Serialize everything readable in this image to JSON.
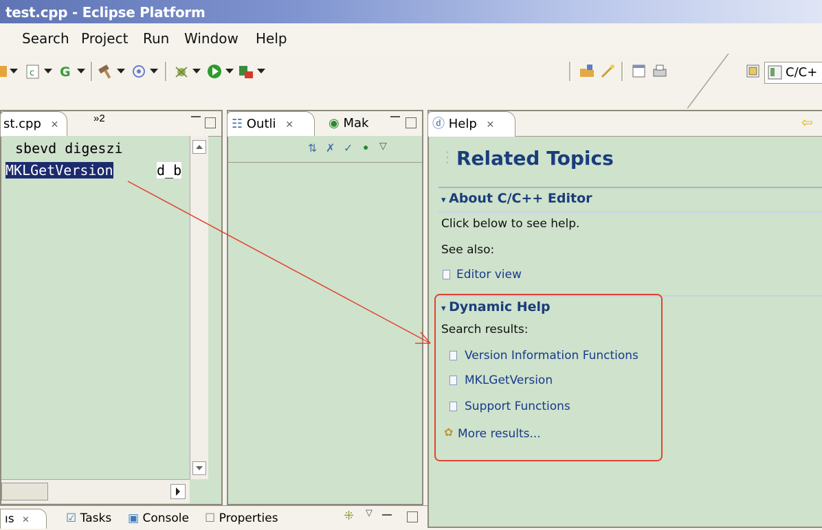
{
  "window": {
    "title": "test.cpp - Eclipse Platform"
  },
  "menu": {
    "items": [
      "Search",
      "Project",
      "Run",
      "Window",
      "Help"
    ]
  },
  "perspective": {
    "label": "C/C+"
  },
  "editor": {
    "tab_label": "st.cpp",
    "overflow_label": "»2",
    "lines": [
      "sbevd digeszi",
      "MKLGetVersion",
      "d_b"
    ]
  },
  "outline": {
    "tabs": [
      "Outli",
      "Mak"
    ]
  },
  "help": {
    "tab_label": "Help",
    "title": "Related Topics",
    "about": {
      "header": "About C/C++ Editor",
      "intro": "Click below to see help.",
      "see_also": "See also:",
      "link": "Editor view"
    },
    "dynamic": {
      "header": "Dynamic Help",
      "search_results_label": "Search results:",
      "results": [
        "Version Information Functions",
        "MKLGetVersion",
        "Support Functions"
      ],
      "more": "More results..."
    }
  },
  "bottom_tabs": [
    "ıs",
    "Tasks",
    "Console",
    "Properties"
  ],
  "colors": {
    "panel_bg": "#cfe2cc",
    "selection": "#1c2a6e",
    "help_blue": "#1a3d7c",
    "annotation_red": "#e0432e"
  }
}
